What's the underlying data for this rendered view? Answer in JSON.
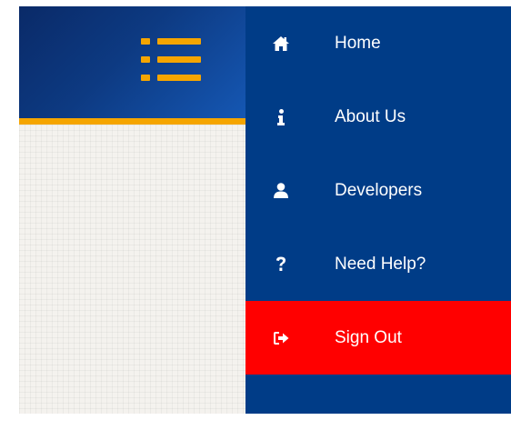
{
  "menu": {
    "items": [
      {
        "label": "Home",
        "icon": "home-icon"
      },
      {
        "label": "About Us",
        "icon": "info-icon"
      },
      {
        "label": "Developers",
        "icon": "user-icon"
      },
      {
        "label": "Need Help?",
        "icon": "question-icon"
      },
      {
        "label": "Sign Out",
        "icon": "sign-out-icon",
        "active": true
      }
    ]
  },
  "colors": {
    "menu_background": "#003c87",
    "active_item": "#ff0000",
    "accent": "#f5a500",
    "pattern_background": "#f4f2ee"
  }
}
